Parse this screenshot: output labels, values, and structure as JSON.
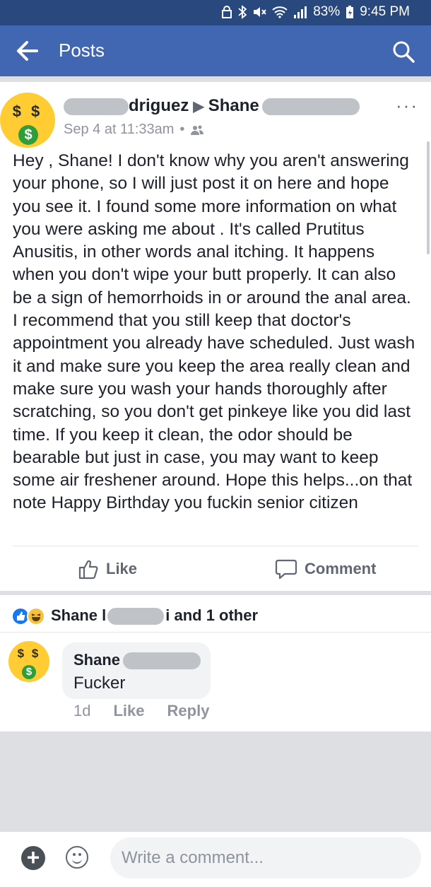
{
  "status_bar": {
    "battery": "83%",
    "time": "9:45 PM"
  },
  "nav": {
    "title": "Posts",
    "icons": [
      "back-arrow-icon",
      "search-icon"
    ]
  },
  "post": {
    "author_visible": "driguez",
    "target_visible": "Shane",
    "timestamp": "Sep 4 at 11:33am",
    "audience_icon": "friends-icon",
    "more_label": "···",
    "avatar_eyes": "$ $",
    "avatar_mouth": "$",
    "text": "Hey , Shane! I don't know why you aren't answering your phone, so I will just post it on here and hope you see it. I found some more information on what you were asking me about . It's called Prutitus Anusitis, in other words anal itching. It happens when you don't wipe your butt properly. It can also be a sign of hemorrhoids in or around the anal area. I recommend that you still keep that doctor's appointment you already have scheduled. Just wash it and make sure you keep the area really clean and make sure you wash your hands thoroughly after scratching, so you don't get pinkeye like you did last time. If you keep it clean, the odor should be bearable but just in case, you may want to keep some air freshener around. Hope this helps...on that note Happy Birthday you fuckin senior citizen"
  },
  "actions": {
    "like": "Like",
    "comment": "Comment"
  },
  "reactions": {
    "name_visible": "Shane l",
    "suffix": "i and 1 other"
  },
  "comment": {
    "author_visible": "Shane",
    "text": "Fucker",
    "avatar_eyes": "$ $",
    "avatar_mouth": "$",
    "age": "1d",
    "like": "Like",
    "reply": "Reply"
  },
  "composer": {
    "plus": "+",
    "placeholder": "Write a comment..."
  },
  "colors": {
    "header_blue": "#4267b2",
    "status_blue": "#29487d",
    "avatar_yellow": "#ffcc33",
    "money_green": "#2e9e3a",
    "like_blue": "#1877f2"
  }
}
